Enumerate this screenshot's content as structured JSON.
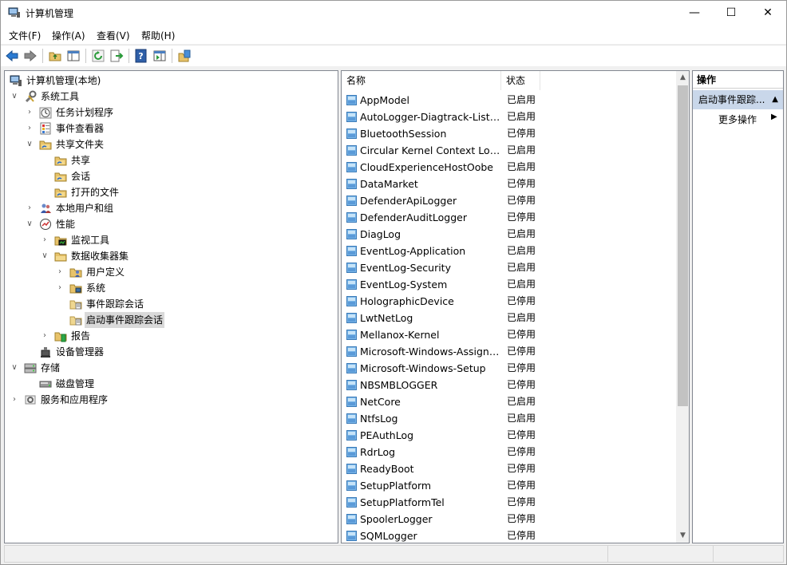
{
  "window": {
    "title": "计算机管理",
    "controls": {
      "minimize": "—",
      "maximize": "☐",
      "close": "✕"
    }
  },
  "menu": [
    "文件(F)",
    "操作(A)",
    "查看(V)",
    "帮助(H)"
  ],
  "tree": [
    {
      "label": "计算机管理(本地)",
      "icon": "computer-management-icon",
      "expander": "",
      "level": 0
    },
    {
      "label": "系统工具",
      "icon": "tools-icon",
      "expander": "expanded",
      "level": 0
    },
    {
      "label": "任务计划程序",
      "icon": "clock-icon",
      "expander": "collapsed",
      "level": 1
    },
    {
      "label": "事件查看器",
      "icon": "event-viewer-icon",
      "expander": "collapsed",
      "level": 1
    },
    {
      "label": "共享文件夹",
      "icon": "shared-folder-icon",
      "expander": "expanded",
      "level": 1
    },
    {
      "label": "共享",
      "icon": "shared-folder-icon",
      "expander": "",
      "level": 2
    },
    {
      "label": "会话",
      "icon": "shared-folder-icon",
      "expander": "",
      "level": 2
    },
    {
      "label": "打开的文件",
      "icon": "shared-folder-icon",
      "expander": "",
      "level": 2
    },
    {
      "label": "本地用户和组",
      "icon": "users-icon",
      "expander": "collapsed",
      "level": 1
    },
    {
      "label": "性能",
      "icon": "performance-icon",
      "expander": "expanded",
      "level": 1
    },
    {
      "label": "监视工具",
      "icon": "monitor-folder-icon",
      "expander": "collapsed",
      "level": 2
    },
    {
      "label": "数据收集器集",
      "icon": "folder-icon",
      "expander": "expanded",
      "level": 2
    },
    {
      "label": "用户定义",
      "icon": "user-folder-icon",
      "expander": "collapsed",
      "level": 3
    },
    {
      "label": "系统",
      "icon": "system-folder-icon",
      "expander": "collapsed",
      "level": 3
    },
    {
      "label": "事件跟踪会话",
      "icon": "trace-folder-icon",
      "expander": "",
      "level": 3
    },
    {
      "label": "启动事件跟踪会话",
      "icon": "trace-folder-icon",
      "expander": "",
      "level": 3,
      "selected": true
    },
    {
      "label": "报告",
      "icon": "report-folder-icon",
      "expander": "collapsed",
      "level": 2
    },
    {
      "label": "设备管理器",
      "icon": "device-manager-icon",
      "expander": "",
      "level": 1
    },
    {
      "label": "存储",
      "icon": "storage-icon",
      "expander": "expanded",
      "level": 0
    },
    {
      "label": "磁盘管理",
      "icon": "disk-icon",
      "expander": "",
      "level": 1
    },
    {
      "label": "服务和应用程序",
      "icon": "services-icon",
      "expander": "collapsed",
      "level": 0
    }
  ],
  "list": {
    "columns": [
      "名称",
      "状态"
    ],
    "rows": [
      {
        "name": "AppModel",
        "status": "已启用"
      },
      {
        "name": "AutoLogger-Diagtrack-Listener",
        "status": "已启用"
      },
      {
        "name": "BluetoothSession",
        "status": "已停用"
      },
      {
        "name": "Circular Kernel Context Logger",
        "status": "已启用"
      },
      {
        "name": "CloudExperienceHostOobe",
        "status": "已启用"
      },
      {
        "name": "DataMarket",
        "status": "已停用"
      },
      {
        "name": "DefenderApiLogger",
        "status": "已停用"
      },
      {
        "name": "DefenderAuditLogger",
        "status": "已停用"
      },
      {
        "name": "DiagLog",
        "status": "已启用"
      },
      {
        "name": "EventLog-Application",
        "status": "已启用"
      },
      {
        "name": "EventLog-Security",
        "status": "已启用"
      },
      {
        "name": "EventLog-System",
        "status": "已启用"
      },
      {
        "name": "HolographicDevice",
        "status": "已停用"
      },
      {
        "name": "LwtNetLog",
        "status": "已启用"
      },
      {
        "name": "Mellanox-Kernel",
        "status": "已停用"
      },
      {
        "name": "Microsoft-Windows-AssignedAccess",
        "status": "已停用"
      },
      {
        "name": "Microsoft-Windows-Setup",
        "status": "已停用"
      },
      {
        "name": "NBSMBLOGGER",
        "status": "已停用"
      },
      {
        "name": "NetCore",
        "status": "已启用"
      },
      {
        "name": "NtfsLog",
        "status": "已启用"
      },
      {
        "name": "PEAuthLog",
        "status": "已停用"
      },
      {
        "name": "RdrLog",
        "status": "已停用"
      },
      {
        "name": "ReadyBoot",
        "status": "已停用"
      },
      {
        "name": "SetupPlatform",
        "status": "已停用"
      },
      {
        "name": "SetupPlatformTel",
        "status": "已停用"
      },
      {
        "name": "SpoolerLogger",
        "status": "已停用"
      },
      {
        "name": "SQMLogger",
        "status": "已停用"
      }
    ]
  },
  "actions": {
    "header": "操作",
    "selected": "启动事件跟踪...",
    "more": "更多操作"
  },
  "colors": {
    "selection": "#c9d7ea",
    "tree_selection": "#d9d9d9",
    "scroll_thumb": "#c2c2c2"
  }
}
